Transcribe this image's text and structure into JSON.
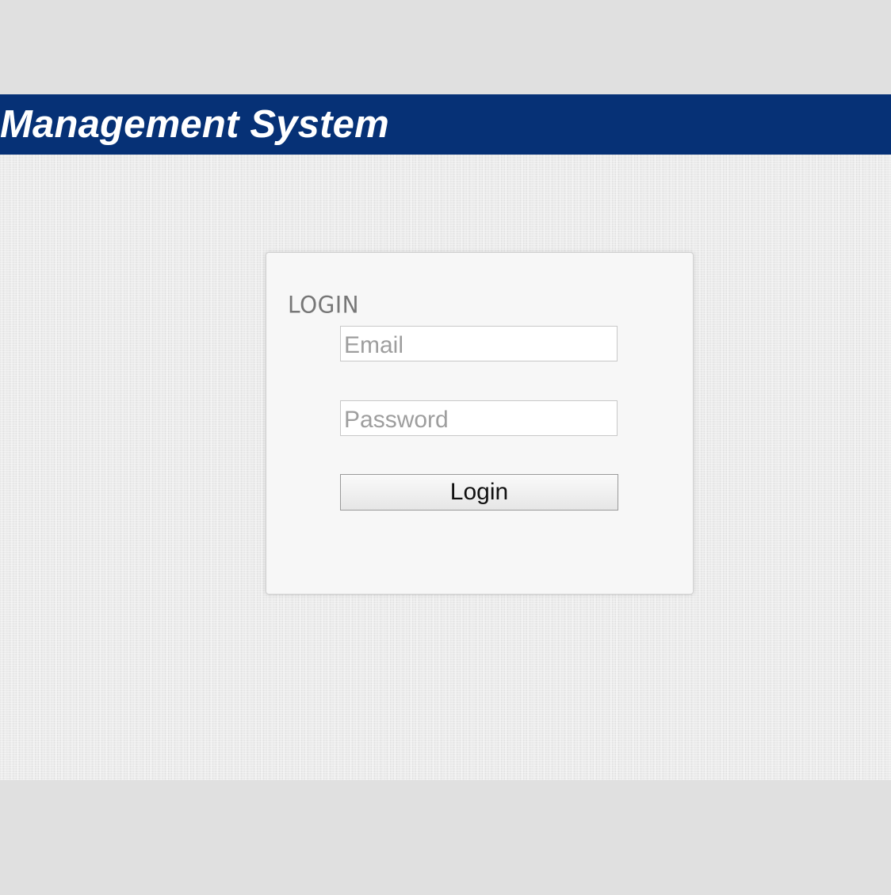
{
  "header": {
    "title": "Management System",
    "background_color": "#063176"
  },
  "login": {
    "heading": "LOGIN",
    "email": {
      "placeholder": "Email",
      "value": ""
    },
    "password": {
      "placeholder": "Password",
      "value": ""
    },
    "submit_label": "Login"
  }
}
